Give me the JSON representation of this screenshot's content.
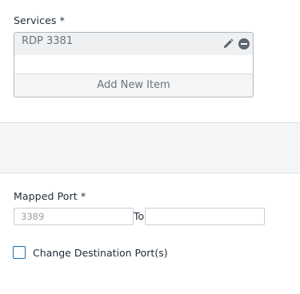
{
  "services": {
    "label": "Services *",
    "items": [
      {
        "label": "RDP 3381"
      }
    ],
    "add_label": "Add New Item"
  },
  "mapped_port": {
    "label": "Mapped Port *",
    "from_placeholder": "3389",
    "from_value": "",
    "to_label": "To",
    "to_value": ""
  },
  "change_destination": {
    "label": "Change Destination Port(s)",
    "checked": false
  },
  "colors": {
    "accent": "#1a6fb0",
    "icon": "#5e6670",
    "band": "#f4f5f6"
  }
}
